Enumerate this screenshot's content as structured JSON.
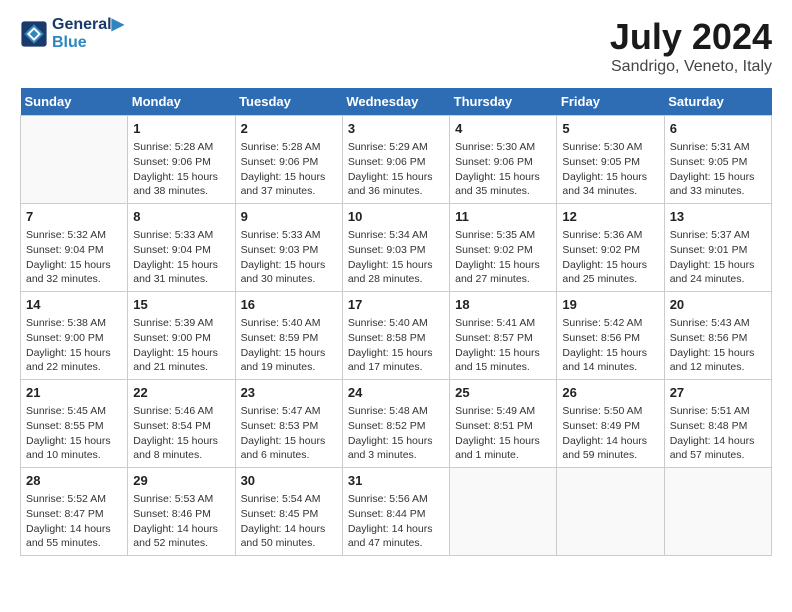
{
  "header": {
    "logo_line1": "General",
    "logo_line2": "Blue",
    "month_year": "July 2024",
    "location": "Sandrigo, Veneto, Italy"
  },
  "days_of_week": [
    "Sunday",
    "Monday",
    "Tuesday",
    "Wednesday",
    "Thursday",
    "Friday",
    "Saturday"
  ],
  "weeks": [
    [
      {
        "day": "",
        "info": ""
      },
      {
        "day": "1",
        "info": "Sunrise: 5:28 AM\nSunset: 9:06 PM\nDaylight: 15 hours\nand 38 minutes."
      },
      {
        "day": "2",
        "info": "Sunrise: 5:28 AM\nSunset: 9:06 PM\nDaylight: 15 hours\nand 37 minutes."
      },
      {
        "day": "3",
        "info": "Sunrise: 5:29 AM\nSunset: 9:06 PM\nDaylight: 15 hours\nand 36 minutes."
      },
      {
        "day": "4",
        "info": "Sunrise: 5:30 AM\nSunset: 9:06 PM\nDaylight: 15 hours\nand 35 minutes."
      },
      {
        "day": "5",
        "info": "Sunrise: 5:30 AM\nSunset: 9:05 PM\nDaylight: 15 hours\nand 34 minutes."
      },
      {
        "day": "6",
        "info": "Sunrise: 5:31 AM\nSunset: 9:05 PM\nDaylight: 15 hours\nand 33 minutes."
      }
    ],
    [
      {
        "day": "7",
        "info": "Sunrise: 5:32 AM\nSunset: 9:04 PM\nDaylight: 15 hours\nand 32 minutes."
      },
      {
        "day": "8",
        "info": "Sunrise: 5:33 AM\nSunset: 9:04 PM\nDaylight: 15 hours\nand 31 minutes."
      },
      {
        "day": "9",
        "info": "Sunrise: 5:33 AM\nSunset: 9:03 PM\nDaylight: 15 hours\nand 30 minutes."
      },
      {
        "day": "10",
        "info": "Sunrise: 5:34 AM\nSunset: 9:03 PM\nDaylight: 15 hours\nand 28 minutes."
      },
      {
        "day": "11",
        "info": "Sunrise: 5:35 AM\nSunset: 9:02 PM\nDaylight: 15 hours\nand 27 minutes."
      },
      {
        "day": "12",
        "info": "Sunrise: 5:36 AM\nSunset: 9:02 PM\nDaylight: 15 hours\nand 25 minutes."
      },
      {
        "day": "13",
        "info": "Sunrise: 5:37 AM\nSunset: 9:01 PM\nDaylight: 15 hours\nand 24 minutes."
      }
    ],
    [
      {
        "day": "14",
        "info": "Sunrise: 5:38 AM\nSunset: 9:00 PM\nDaylight: 15 hours\nand 22 minutes."
      },
      {
        "day": "15",
        "info": "Sunrise: 5:39 AM\nSunset: 9:00 PM\nDaylight: 15 hours\nand 21 minutes."
      },
      {
        "day": "16",
        "info": "Sunrise: 5:40 AM\nSunset: 8:59 PM\nDaylight: 15 hours\nand 19 minutes."
      },
      {
        "day": "17",
        "info": "Sunrise: 5:40 AM\nSunset: 8:58 PM\nDaylight: 15 hours\nand 17 minutes."
      },
      {
        "day": "18",
        "info": "Sunrise: 5:41 AM\nSunset: 8:57 PM\nDaylight: 15 hours\nand 15 minutes."
      },
      {
        "day": "19",
        "info": "Sunrise: 5:42 AM\nSunset: 8:56 PM\nDaylight: 15 hours\nand 14 minutes."
      },
      {
        "day": "20",
        "info": "Sunrise: 5:43 AM\nSunset: 8:56 PM\nDaylight: 15 hours\nand 12 minutes."
      }
    ],
    [
      {
        "day": "21",
        "info": "Sunrise: 5:45 AM\nSunset: 8:55 PM\nDaylight: 15 hours\nand 10 minutes."
      },
      {
        "day": "22",
        "info": "Sunrise: 5:46 AM\nSunset: 8:54 PM\nDaylight: 15 hours\nand 8 minutes."
      },
      {
        "day": "23",
        "info": "Sunrise: 5:47 AM\nSunset: 8:53 PM\nDaylight: 15 hours\nand 6 minutes."
      },
      {
        "day": "24",
        "info": "Sunrise: 5:48 AM\nSunset: 8:52 PM\nDaylight: 15 hours\nand 3 minutes."
      },
      {
        "day": "25",
        "info": "Sunrise: 5:49 AM\nSunset: 8:51 PM\nDaylight: 15 hours\nand 1 minute."
      },
      {
        "day": "26",
        "info": "Sunrise: 5:50 AM\nSunset: 8:49 PM\nDaylight: 14 hours\nand 59 minutes."
      },
      {
        "day": "27",
        "info": "Sunrise: 5:51 AM\nSunset: 8:48 PM\nDaylight: 14 hours\nand 57 minutes."
      }
    ],
    [
      {
        "day": "28",
        "info": "Sunrise: 5:52 AM\nSunset: 8:47 PM\nDaylight: 14 hours\nand 55 minutes."
      },
      {
        "day": "29",
        "info": "Sunrise: 5:53 AM\nSunset: 8:46 PM\nDaylight: 14 hours\nand 52 minutes."
      },
      {
        "day": "30",
        "info": "Sunrise: 5:54 AM\nSunset: 8:45 PM\nDaylight: 14 hours\nand 50 minutes."
      },
      {
        "day": "31",
        "info": "Sunrise: 5:56 AM\nSunset: 8:44 PM\nDaylight: 14 hours\nand 47 minutes."
      },
      {
        "day": "",
        "info": ""
      },
      {
        "day": "",
        "info": ""
      },
      {
        "day": "",
        "info": ""
      }
    ]
  ]
}
